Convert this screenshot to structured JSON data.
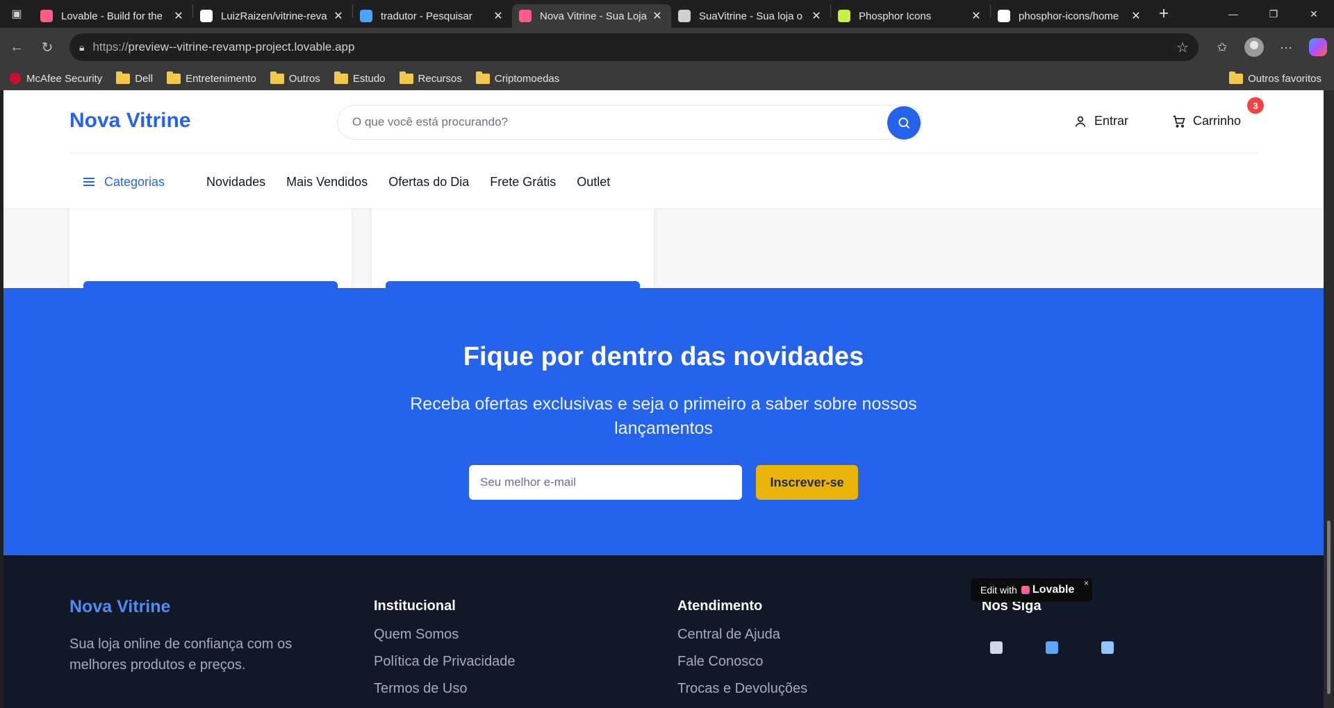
{
  "browser": {
    "tabs": [
      {
        "title": "Lovable - Build for the",
        "icon": "lovable-heart-icon",
        "color": "#ff5c8a"
      },
      {
        "title": "LuizRaizen/vitrine-reva",
        "icon": "github-icon",
        "color": "#ffffff"
      },
      {
        "title": "tradutor - Pesquisar",
        "icon": "search-icon",
        "color": "#4aa3ff"
      },
      {
        "title": "Nova Vitrine - Sua Loja",
        "icon": "lovable-heart-icon",
        "color": "#ff5c8a",
        "active": true
      },
      {
        "title": "SuaVitrine - Sua loja o",
        "icon": "page-icon",
        "color": "#cfcfcf"
      },
      {
        "title": "Phosphor Icons",
        "icon": "phosphor-icon",
        "color": "#c5f048"
      },
      {
        "title": "phosphor-icons/home",
        "icon": "github-icon",
        "color": "#ffffff"
      }
    ],
    "url_proto": "https://",
    "url_rest": "preview--vitrine-revamp-project.lovable.app",
    "bookmarks": [
      "McAfee Security",
      "Dell",
      "Entretenimento",
      "Outros",
      "Estudo",
      "Recursos",
      "Criptomoedas"
    ],
    "other_favorites": "Outros favoritos"
  },
  "header": {
    "logo": "Nova Vitrine",
    "search_placeholder": "O que você está procurando?",
    "login_label": "Entrar",
    "cart_label": "Carrinho",
    "cart_count": "3",
    "categories_label": "Categorias",
    "nav_links": [
      "Novidades",
      "Mais Vendidos",
      "Ofertas do Dia",
      "Frete Grátis",
      "Outlet"
    ]
  },
  "newsletter": {
    "title": "Fique por dentro das novidades",
    "subtitle": "Receba ofertas exclusivas e seja o primeiro a saber sobre nossos lançamentos",
    "email_placeholder": "Seu melhor e-mail",
    "subscribe_label": "Inscrever-se"
  },
  "footer": {
    "logo": "Nova Vitrine",
    "tagline": "Sua loja online de confiança com os melhores produtos e preços.",
    "columns": [
      {
        "title": "Institucional",
        "links": [
          "Quem Somos",
          "Política de Privacidade",
          "Termos de Uso"
        ]
      },
      {
        "title": "Atendimento",
        "links": [
          "Central de Ajuda",
          "Fale Conosco",
          "Trocas e Devoluções"
        ]
      },
      {
        "title": "Nos Siga",
        "links": []
      }
    ],
    "social_icons": [
      "camera-icon",
      "phone-icon",
      "tv-icon"
    ]
  },
  "badge": {
    "prefix": "Edit with",
    "brand": "Lovable",
    "close": "×"
  },
  "colors": {
    "primary": "#2563eb",
    "accent": "#eab308",
    "footer_bg": "#111827",
    "badge_red": "#ef4444"
  }
}
